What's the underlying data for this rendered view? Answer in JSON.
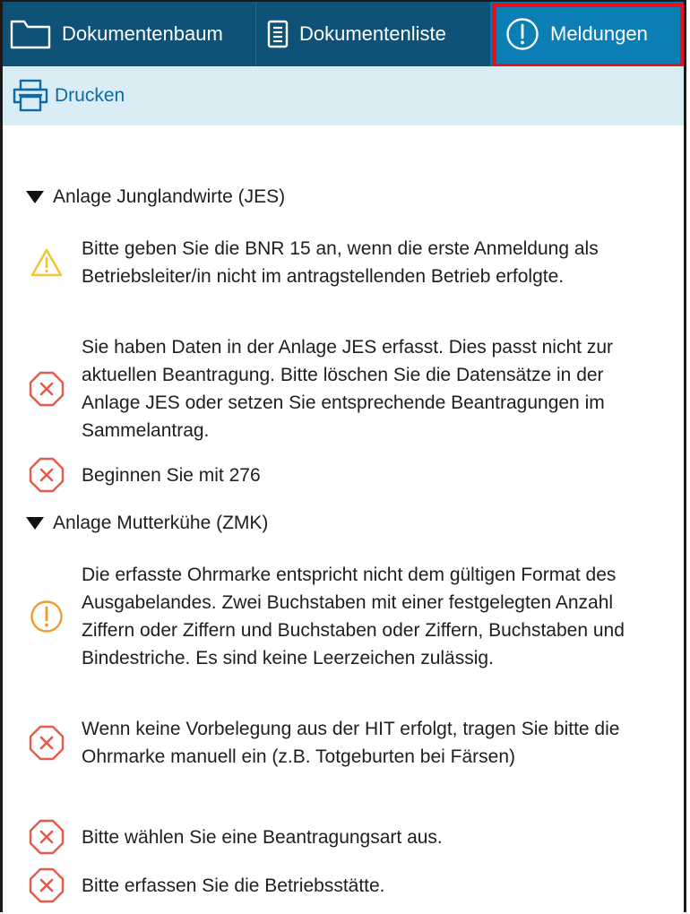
{
  "tabs": {
    "doctree_label": "Dokumentenbaum",
    "doclist_label": "Dokumentenliste",
    "messages_label": "Meldungen",
    "active": "Meldungen"
  },
  "toolbar": {
    "print_label": "Drucken"
  },
  "colors": {
    "tabbar_bg": "#0f5278",
    "active_tab_bg": "#0b7eb5",
    "highlight_border": "#e8101b",
    "toolbar_bg": "#daedf4",
    "link_blue": "#0d6aa6",
    "warning_yellow": "#f2c230",
    "notice_orange": "#f09a2c",
    "error_red": "#e85a4a"
  },
  "sections": [
    {
      "title": "Anlage Junglandwirte (JES)",
      "expanded": true,
      "messages": [
        {
          "severity": "warning",
          "icon": "warning-triangle-icon",
          "text": "Bitte geben Sie die BNR 15 an, wenn die erste Anmeldung als Betriebsleiter/in nicht im antragstellenden Betrieb erfolgte."
        },
        {
          "severity": "error",
          "icon": "error-octagon-icon",
          "text": "Sie haben Daten in der Anlage JES erfasst. Dies passt nicht zur aktuellen Beantragung. Bitte löschen Sie die Datensätze in der Anlage JES oder setzen Sie entsprechende Beantragungen im Sammelantrag."
        },
        {
          "severity": "error",
          "icon": "error-octagon-icon",
          "text": "Beginnen Sie mit 276"
        }
      ]
    },
    {
      "title": "Anlage Mutterkühe (ZMK)",
      "expanded": true,
      "messages": [
        {
          "severity": "notice",
          "icon": "exclamation-circle-icon",
          "text": "Die erfasste Ohrmarke entspricht nicht dem gültigen Format des Ausgabelandes. Zwei Buchstaben mit einer festgelegten Anzahl Ziffern oder Ziffern und Buchstaben oder Ziffern, Buchstaben und Bindestriche. Es sind keine Leerzeichen zulässig."
        },
        {
          "severity": "error",
          "icon": "error-octagon-icon",
          "text": "Wenn keine Vorbelegung aus der HIT erfolgt, tragen Sie bitte die Ohrmarke manuell ein (z.B. Totgeburten bei Färsen)"
        },
        {
          "severity": "error",
          "icon": "error-octagon-icon",
          "text": "Bitte wählen Sie eine Beantragungsart aus."
        },
        {
          "severity": "error",
          "icon": "error-octagon-icon",
          "text": "Bitte erfassen Sie die Betriebsstätte."
        }
      ]
    }
  ]
}
